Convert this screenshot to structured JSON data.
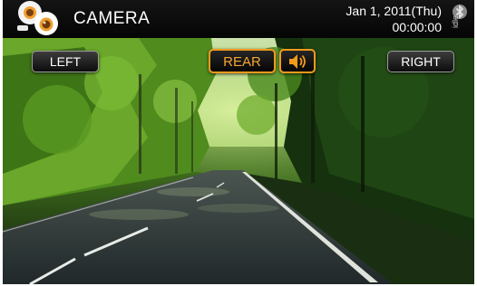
{
  "header": {
    "title": "CAMERA",
    "date": "Jan 1, 2011(Thu)",
    "time": "00:00:00",
    "bluetooth_status": "idle",
    "logo_icon": "camera-app-icon"
  },
  "controls": {
    "left_label": "LEFT",
    "rear_label": "REAR",
    "right_label": "RIGHT",
    "sound_icon": "speaker-icon"
  },
  "colors": {
    "accent": "#f29a1c",
    "header_bg": "#0a0a0a",
    "button_text": "#ffffff"
  }
}
